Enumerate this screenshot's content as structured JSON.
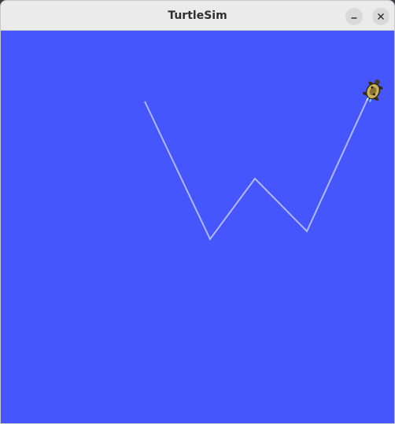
{
  "window": {
    "title": "TurtleSim"
  },
  "controls": {
    "minimize_icon": "minimize-icon",
    "close_icon": "close-icon"
  },
  "canvas": {
    "background_color": "#4556ff",
    "pen_color": "#b3b8ff"
  }
}
